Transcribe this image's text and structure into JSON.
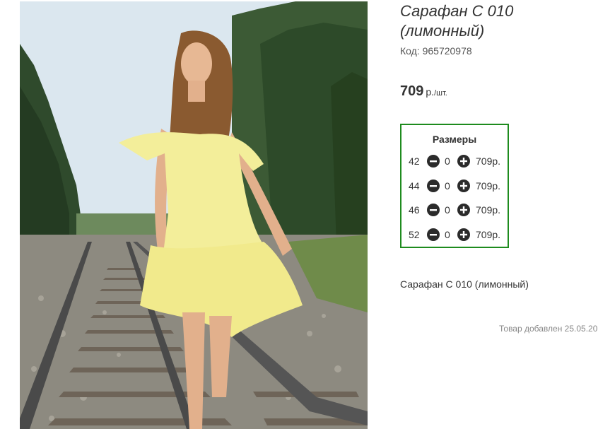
{
  "product": {
    "title_line1": "Сарафан С 010",
    "title_line2": "(лимонный)",
    "code_label": "Код:",
    "code_value": "965720978",
    "price_value": "709",
    "price_currency": "р.",
    "price_unit": "/шт.",
    "description": "Сарафан С 010 (лимонный)",
    "added_text": "Товар добавлен 25.05.20"
  },
  "sizes": {
    "title": "Размеры",
    "rows": [
      {
        "size": "42",
        "qty": "0",
        "price": "709р."
      },
      {
        "size": "44",
        "qty": "0",
        "price": "709р."
      },
      {
        "size": "46",
        "qty": "0",
        "price": "709р."
      },
      {
        "size": "52",
        "qty": "0",
        "price": "709р."
      }
    ]
  },
  "icons": {
    "minus": "minus-circle-icon",
    "plus": "plus-circle-icon"
  },
  "colors": {
    "sizes_border": "#1e8b1e",
    "button": "#2b2b2b",
    "dress": "#f3ee9a"
  }
}
